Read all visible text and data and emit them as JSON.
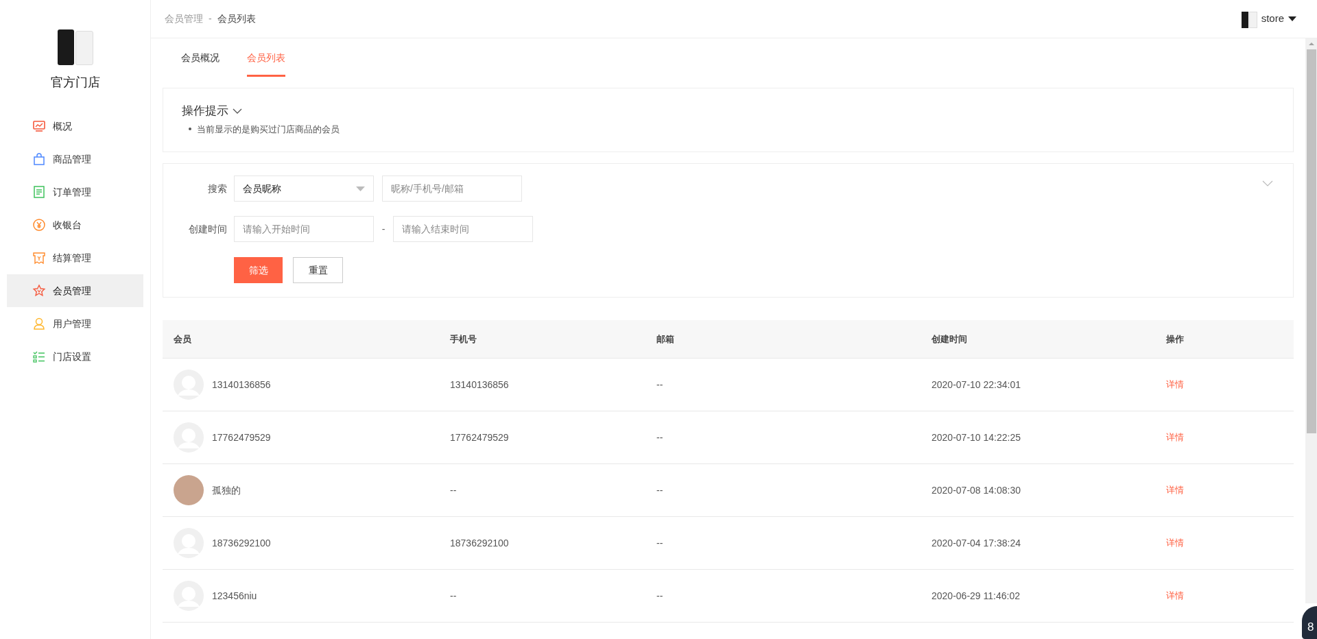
{
  "sidebar": {
    "store_name": "官方门店",
    "items": [
      {
        "label": "概况",
        "selected": false
      },
      {
        "label": "商品管理",
        "selected": false
      },
      {
        "label": "订单管理",
        "selected": false
      },
      {
        "label": "收银台",
        "selected": false
      },
      {
        "label": "结算管理",
        "selected": false
      },
      {
        "label": "会员管理",
        "selected": true
      },
      {
        "label": "用户管理",
        "selected": false
      },
      {
        "label": "门店设置",
        "selected": false
      }
    ]
  },
  "breadcrumb": [
    "会员管理",
    "-",
    "会员列表"
  ],
  "user_menu": {
    "name": "store"
  },
  "tabs": [
    {
      "label": "会员概况",
      "selected": false
    },
    {
      "label": "会员列表",
      "selected": true
    }
  ],
  "tips": {
    "title": "操作提示",
    "items": [
      "当前显示的是购买过门店商品的会员"
    ]
  },
  "filter": {
    "search_label": "搜索",
    "search_type": "会员昵称",
    "search_placeholder": "昵称/手机号/邮箱",
    "date_label": "创建时间",
    "start_placeholder": "请输入开始时间",
    "separator": "-",
    "end_placeholder": "请输入结束时间",
    "submit": "筛选",
    "reset": "重置"
  },
  "table": {
    "columns": [
      "会员",
      "手机号",
      "邮箱",
      "创建时间",
      "操作"
    ],
    "rows": [
      {
        "kind": "default",
        "member": "13140136856",
        "phone": "13140136856",
        "email": "--",
        "created": "2020-07-10 22:34:01",
        "action": "详情"
      },
      {
        "kind": "default",
        "member": "17762479529",
        "phone": "17762479529",
        "email": "--",
        "created": "2020-07-10 14:22:25",
        "action": "详情"
      },
      {
        "kind": "photo",
        "member": "孤独的",
        "phone": "--",
        "email": "--",
        "created": "2020-07-08 14:08:30",
        "action": "详情"
      },
      {
        "kind": "default",
        "member": "18736292100",
        "phone": "18736292100",
        "email": "--",
        "created": "2020-07-04 17:38:24",
        "action": "详情"
      },
      {
        "kind": "default",
        "member": "123456niu",
        "phone": "--",
        "email": "--",
        "created": "2020-06-29 11:46:02",
        "action": "详情"
      }
    ]
  },
  "floating_badge": "8"
}
